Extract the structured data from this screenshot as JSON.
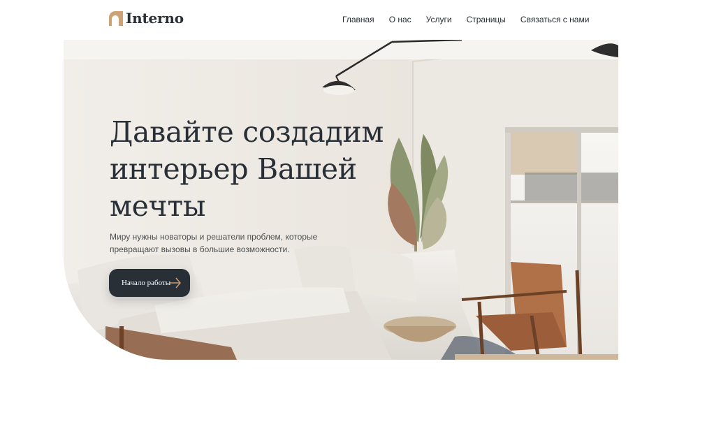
{
  "brand": {
    "name": "Interno",
    "accent": "#cda274",
    "dark": "#292f36"
  },
  "nav": {
    "items": [
      {
        "label": "Главная"
      },
      {
        "label": "О нас"
      },
      {
        "label": "Услуги"
      },
      {
        "label": "Страницы"
      },
      {
        "label": "Связаться с нами"
      }
    ]
  },
  "hero": {
    "title": "Давайте создадим интерьер Вашей мечты",
    "subtitle": "Миру нужны новаторы и решатели проблем, которые превращают вызовы в большие возможности.",
    "cta_label": "Начало работы",
    "cta_icon": "arrow-right-icon",
    "image_alt": "living-room-photo"
  }
}
